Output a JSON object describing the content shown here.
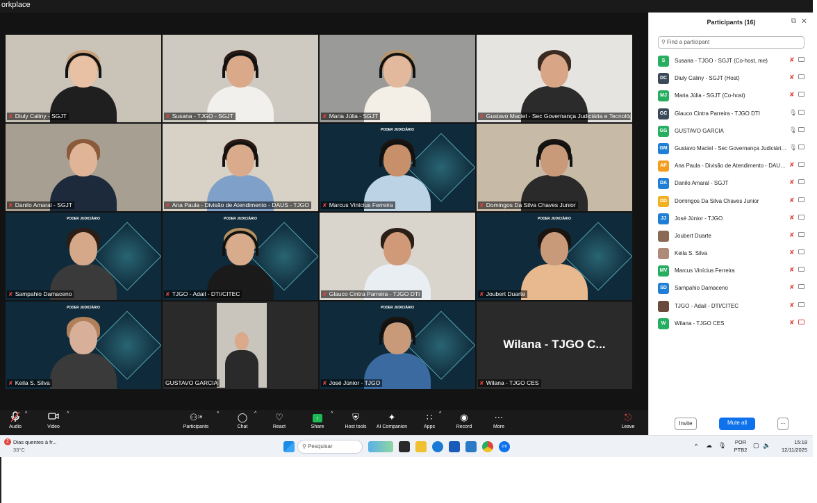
{
  "window": {
    "title": "orkplace"
  },
  "participants_panel": {
    "title": "Participants (16)",
    "search_placeholder": "Find a participant",
    "invite_label": "Invite",
    "mute_all_label": "Mute all",
    "more_label": "···",
    "participants": [
      {
        "initials": "S",
        "color": "#27ae60",
        "name": "Susana - TJGO - SGJT (Co-host, me)",
        "mic": "muted",
        "video": "off"
      },
      {
        "initials": "DC",
        "color": "#3b4a5a",
        "name": "Diuly Caliny - SGJT (Host)",
        "mic": "muted",
        "video": "off"
      },
      {
        "initials": "MJ",
        "color": "#27ae60",
        "name": "Maria Júlia - SGJT (Co-host)",
        "mic": "muted",
        "video": "off"
      },
      {
        "initials": "GC",
        "color": "#3b4a5a",
        "name": "Glauco Cintra Parreira - TJGO DTI",
        "mic": "on",
        "video": "off"
      },
      {
        "initials": "GG",
        "color": "#27ae60",
        "name": "GUSTAVO GARCIA",
        "mic": "on",
        "video": "off"
      },
      {
        "initials": "GM",
        "color": "#1f7fd6",
        "name": "Gustavo Maciel - Sec Governança Judiciária e Tecnológica",
        "mic": "on",
        "video": "off"
      },
      {
        "initials": "AP",
        "color": "#f29d1f",
        "name": "Ana Paula - Divisão de Atendimento - DAUS - TJGO",
        "mic": "muted",
        "video": "off"
      },
      {
        "initials": "DA",
        "color": "#1f7fd6",
        "name": "Danilo Amaral - SGJT",
        "mic": "muted",
        "video": "off"
      },
      {
        "initials": "DD",
        "color": "#f2b01f",
        "name": "Domingos Da Silva Chaves Junior",
        "mic": "muted",
        "video": "off"
      },
      {
        "initials": "JJ",
        "color": "#1f7fd6",
        "name": "José Júnior - TJGO",
        "mic": "muted",
        "video": "off"
      },
      {
        "initials": "",
        "color": "#8a6a55",
        "name": "Joubert Duarte",
        "mic": "muted",
        "video": "off"
      },
      {
        "initials": "",
        "color": "#b08a78",
        "name": "Keila S. Silva",
        "mic": "muted",
        "video": "off"
      },
      {
        "initials": "MV",
        "color": "#27ae60",
        "name": "Marcus Vinícius Ferreira",
        "mic": "muted",
        "video": "off"
      },
      {
        "initials": "SD",
        "color": "#1f7fd6",
        "name": "Sampahio Damaceno",
        "mic": "muted",
        "video": "off"
      },
      {
        "initials": "",
        "color": "#6a4a3a",
        "name": "TJGO - Adail - DTI/CITEC",
        "mic": "muted",
        "video": "off"
      },
      {
        "initials": "W",
        "color": "#27ae60",
        "name": "Wilana - TJGO CES",
        "mic": "muted",
        "video": "off-red"
      }
    ]
  },
  "tiles": [
    {
      "name": "Diuly Caliny - SGJT",
      "bg": "#c9c3b8",
      "skin": "#e8c0a4",
      "hair": "#c9a27a",
      "shirt": "#1f1f1f",
      "headset": true
    },
    {
      "name": "Susana - TJGO - SGJT",
      "bg": "#cfcac1",
      "skin": "#d9a98a",
      "hair": "#2a1c14",
      "shirt": "#f2f0ec",
      "headset": true
    },
    {
      "name": "Maria Júlia - SGJT",
      "bg": "#9a9a98",
      "skin": "#e3b99d",
      "hair": "#b8956a",
      "shirt": "#f3efe6",
      "headset": true
    },
    {
      "name": "Gustavo Maciel - Sec Governança Judiciária e Tecnológica",
      "bg": "#e6e4e0",
      "skin": "#d8a587",
      "hair": "#3a2a20",
      "shirt": "#2b2b2b",
      "headset": false
    },
    {
      "name": "Danilo Amaral - SGJT",
      "bg": "#a89f93",
      "skin": "#e0b497",
      "hair": "#8a5a3a",
      "shirt": "#1c2a3c",
      "headset": false
    },
    {
      "name": "Ana Paula - Divisão de Atendimento - DAUS - TJGO",
      "bg": "#d8d2c6",
      "skin": "#d9ab8c",
      "hair": "#2a1a12",
      "shirt": "#7fa0c8",
      "headset": true
    },
    {
      "name": "Marcus Vinícius Ferreira",
      "bg": "#0f2a3a",
      "skin": "#c78f6a",
      "hair": "#1a1410",
      "shirt": "#bcd3e6",
      "headset": true,
      "brand": true
    },
    {
      "name": "Domingos Da Silva Chaves Junior",
      "bg": "#c7bba8",
      "skin": "#c99a7a",
      "hair": "#1a1410",
      "shirt": "#2a2a2a",
      "headset": true
    },
    {
      "name": "Sampahio Damaceno",
      "bg": "#0f2a3a",
      "skin": "#d6a88a",
      "hair": "#2a1e16",
      "shirt": "#3a3a3a",
      "headset": false,
      "brand": true
    },
    {
      "name": "TJGO - Adail - DTI/CITEC",
      "bg": "#0f2a3a",
      "skin": "#d8ab8c",
      "hair": "#b89060",
      "shirt": "#1a1a1a",
      "headset": true,
      "brand": true
    },
    {
      "name": "Glauco Cintra Parreira - TJGO DTI",
      "bg": "#d9d4cc",
      "skin": "#d09a78",
      "hair": "#2a1e16",
      "shirt": "#e9eef3",
      "headset": false
    },
    {
      "name": "Joubert Duarte",
      "bg": "#0f2a3a",
      "skin": "#c99a7a",
      "hair": "#1a1410",
      "shirt": "#e8b88e",
      "headset": false,
      "brand": true
    },
    {
      "name": "Keila S. Silva",
      "bg": "#0f2a3a",
      "skin": "#d8b09a",
      "hair": "#b0805a",
      "shirt": "#3a3a3a",
      "headset": false,
      "brand": true
    },
    {
      "name": "GUSTAVO GARCIA",
      "bg": "#2a2a2a",
      "skin": "#d9a98a",
      "hair": "#3a2a20",
      "shirt": "#2a2a2a",
      "headset": false,
      "active": true
    },
    {
      "name": "José Júnior - TJGO",
      "bg": "#0f2a3a",
      "skin": "#c99a7a",
      "hair": "#1a1410",
      "shirt": "#3a6aa0",
      "headset": true,
      "brand": true
    },
    {
      "name": "Wilana - TJGO CES",
      "bg": "#2a2a2a",
      "display_name": "Wilana - TJGO C...",
      "video": "off"
    }
  ],
  "brand_logo_text": "PODER JUDICIÁRIO",
  "toolbar": {
    "audio": "Audio",
    "video": "Video",
    "participants": "Participants",
    "participants_count": "16",
    "chat": "Chat",
    "react": "React",
    "share": "Share",
    "host_tools": "Host tools",
    "ai_companion": "AI Companion",
    "apps": "Apps",
    "record": "Record",
    "more": "More",
    "leave": "Leave"
  },
  "taskbar": {
    "weather_title": "Dias quentes à fr...",
    "weather_temp": "33°C",
    "search_placeholder": "Pesquisar",
    "lang_top": "POR",
    "lang_bottom": "PTB2",
    "time": "15:18",
    "date": "12/11/2025",
    "notification_count": "2"
  }
}
